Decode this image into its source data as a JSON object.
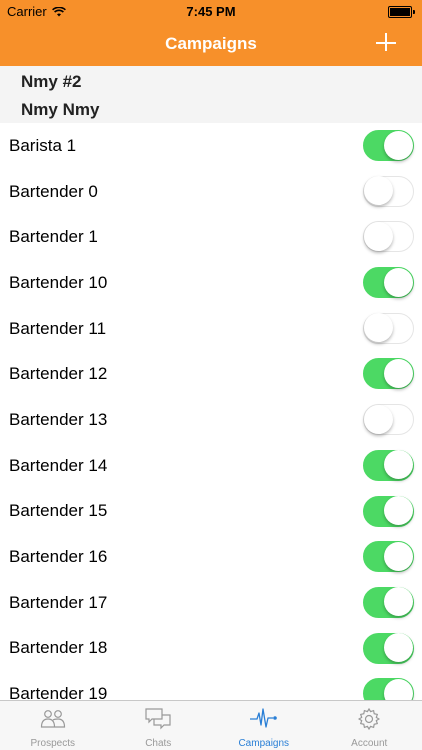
{
  "status_bar": {
    "carrier": "Carrier",
    "time": "7:45 PM"
  },
  "nav": {
    "title": "Campaigns",
    "add_icon": "plus-icon"
  },
  "section": {
    "line1": "Nmy #2",
    "line2": "Nmy Nmy"
  },
  "campaigns": [
    {
      "label": "Barista 1",
      "on": true
    },
    {
      "label": "Bartender 0",
      "on": false
    },
    {
      "label": "Bartender 1",
      "on": false
    },
    {
      "label": "Bartender 10",
      "on": true
    },
    {
      "label": "Bartender 11",
      "on": false
    },
    {
      "label": "Bartender 12",
      "on": true
    },
    {
      "label": "Bartender 13",
      "on": false
    },
    {
      "label": "Bartender 14",
      "on": true
    },
    {
      "label": "Bartender 15",
      "on": true
    },
    {
      "label": "Bartender 16",
      "on": true
    },
    {
      "label": "Bartender 17",
      "on": true
    },
    {
      "label": "Bartender 18",
      "on": true
    },
    {
      "label": "Bartender 19",
      "on": true
    }
  ],
  "tabs": [
    {
      "label": "Prospects",
      "icon": "people-icon",
      "active": false
    },
    {
      "label": "Chats",
      "icon": "chat-bubbles-icon",
      "active": false
    },
    {
      "label": "Campaigns",
      "icon": "pulse-icon",
      "active": true
    },
    {
      "label": "Account",
      "icon": "gear-icon",
      "active": false
    }
  ],
  "colors": {
    "accent": "#f7902a",
    "toggle_on": "#4cd964",
    "tab_active": "#2a7fd6",
    "tab_inactive": "#999999"
  }
}
